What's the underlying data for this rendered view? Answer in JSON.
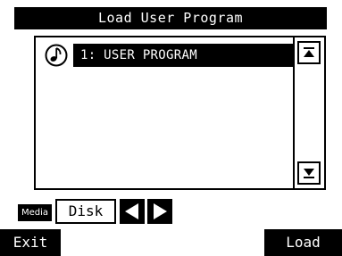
{
  "screen": {
    "title": "Load User Program"
  },
  "program_list": {
    "items": [
      {
        "label": "1: USER PROGRAM",
        "icon": "music-note-icon",
        "selected": true
      }
    ]
  },
  "scrollbar": {
    "up_icon": "scroll-up-icon",
    "down_icon": "scroll-down-icon"
  },
  "media": {
    "tag_label": "Media",
    "value": "Disk",
    "prev_icon": "arrow-left-icon",
    "next_icon": "arrow-right-icon"
  },
  "footer": {
    "exit_label": "Exit",
    "load_label": "Load"
  }
}
